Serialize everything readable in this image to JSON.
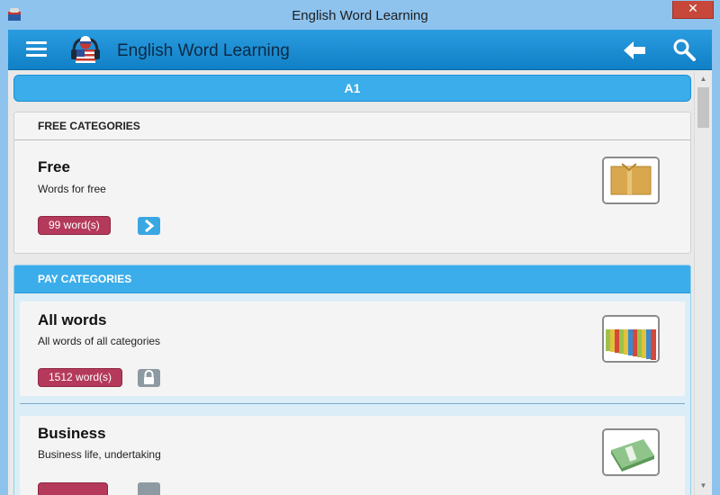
{
  "window": {
    "title": "English Word Learning",
    "close_label": "✕"
  },
  "appbar": {
    "title": "English Word Learning"
  },
  "level": {
    "label": "A1"
  },
  "free_section": {
    "header": "FREE CATEGORIES",
    "items": [
      {
        "name": "Free",
        "description": "Words for free",
        "count_label": "99 word(s)",
        "action": "arrow-right-icon",
        "thumb": "gift-box-icon"
      }
    ]
  },
  "pay_section": {
    "header": "PAY CATEGORIES",
    "items": [
      {
        "name": "All words",
        "description": "All words of all categories",
        "count_label": "1512 word(s)",
        "action": "padlock-icon",
        "thumb": "books-icon"
      },
      {
        "name": "Business",
        "description": "Business life, undertaking",
        "count_label": "",
        "action": "padlock-icon",
        "thumb": "money-stack-icon"
      }
    ]
  },
  "colors": {
    "accent": "#3badea",
    "appbar": "#1a8fd6",
    "badge": "#b4395a",
    "titlebar": "#8ec3ee",
    "close": "#c7473a"
  },
  "scrollbar": {
    "up": "▲",
    "down": "▼"
  }
}
